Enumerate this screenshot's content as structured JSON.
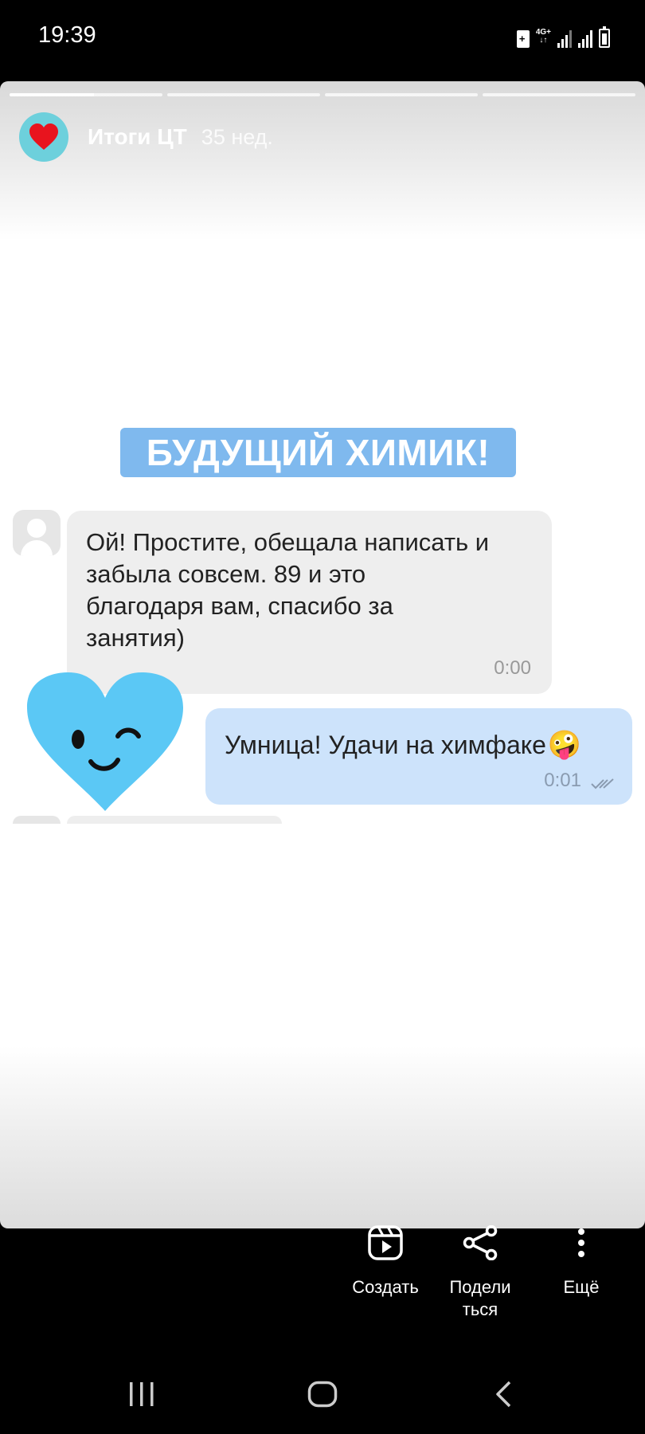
{
  "status_bar": {
    "time": "19:39",
    "network": "4G+"
  },
  "story": {
    "account": "Итоги ЦТ",
    "age": "35 нед.",
    "progress_segments": [
      1.0,
      0.0,
      0.0,
      0.0
    ],
    "banner": "БУДУЩИЙ ХИМИК!"
  },
  "chat": {
    "incoming": {
      "lines": [
        "Ой! Простите, обещала написать и",
        "забыла совсем. 89 и это",
        "благодаря вам, спасибо за",
        "занятия)"
      ],
      "time": "0:00"
    },
    "outgoing": {
      "text": "Умница! Удачи на химфаке",
      "emoji": "🤪",
      "time": "0:01"
    }
  },
  "actions": {
    "create": "Создать",
    "share_line1": "Подели",
    "share_line2": "ться",
    "more": "Ещё"
  },
  "icons": {
    "status": [
      "save-icon",
      "network-icon",
      "signal-icon",
      "battery-icon"
    ],
    "actions": [
      "reels-icon",
      "share-icon",
      "more-vert-icon"
    ],
    "nav": [
      "recents-icon",
      "home-icon",
      "back-icon"
    ]
  },
  "colors": {
    "banner": "#7fb9ee",
    "outgoing_bubble": "#cde3fb",
    "incoming_bubble": "#eeeeee",
    "heart_sticker": "#5bc8f5",
    "avatar_ring": "#6dd0dc"
  }
}
